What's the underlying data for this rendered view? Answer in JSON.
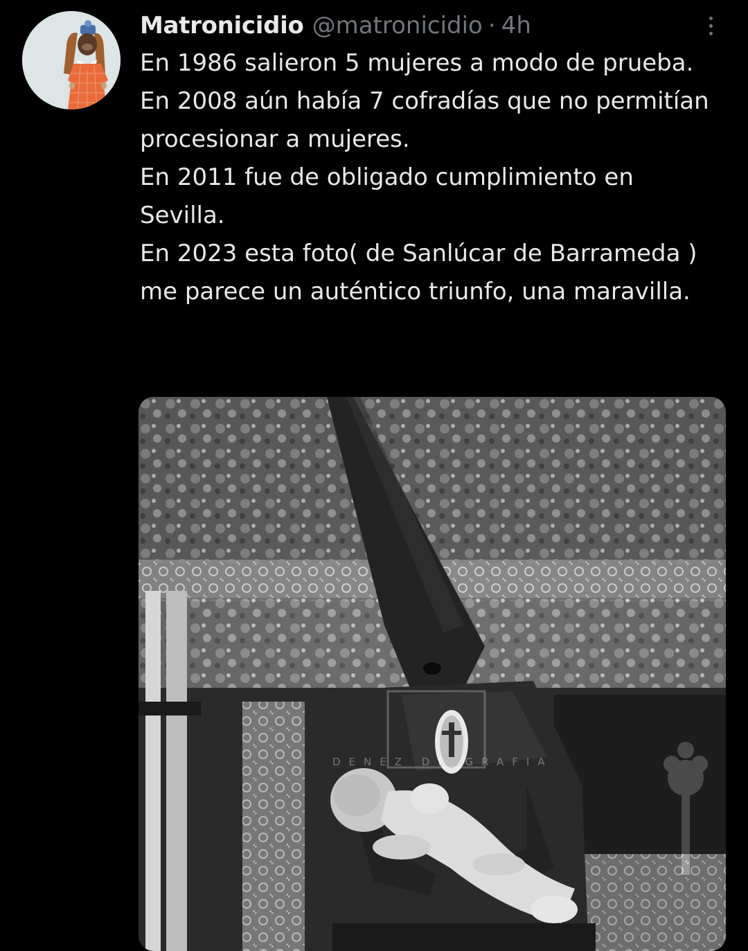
{
  "tweet": {
    "display_name": "Matronicidio",
    "handle": "@matronicidio",
    "separator": "·",
    "time": "4h",
    "paragraphs": [
      "En 1986 salieron 5 mujeres a modo de prueba.",
      "En 2008 aún había 7 cofradías que no permitían procesionar a mujeres.",
      "En 2011 fue de obligado cumplimiento en Sevilla.",
      "En 2023 esta foto( de Sanlúcar de Barrameda )  me parece un auténtico triunfo, una maravilla."
    ],
    "more_icon": "more-vertical-icon"
  },
  "media": {
    "watermark": "DENEZ  DR  GRAFIA"
  },
  "colors": {
    "background": "#000000",
    "text_primary": "#e7e9ea",
    "text_secondary": "#71767b",
    "avatar_bg": "#dde5e6"
  }
}
